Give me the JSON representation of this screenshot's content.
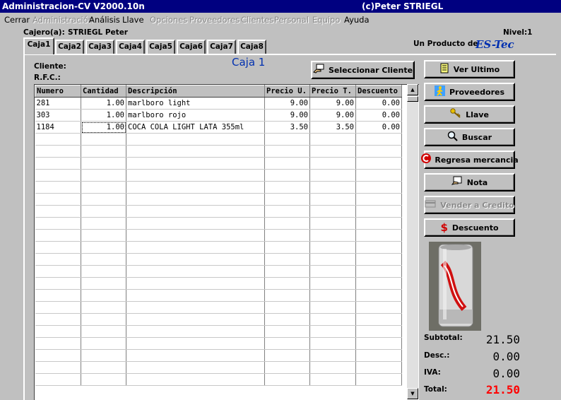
{
  "window": {
    "title": "Administracion-CV V2000.10n",
    "copyright": "(c)Peter STRIEGL"
  },
  "menu": [
    {
      "label": "Cerrar",
      "enabled": true
    },
    {
      "label": "Administración",
      "enabled": false
    },
    {
      "label": "Análisis",
      "enabled": true
    },
    {
      "label": "Llave",
      "enabled": true
    },
    {
      "label": "Opciones",
      "enabled": false
    },
    {
      "label": "Proveedores",
      "enabled": false
    },
    {
      "label": "Clientes",
      "enabled": false
    },
    {
      "label": "Personal",
      "enabled": false
    },
    {
      "label": "Equipo",
      "enabled": false
    },
    {
      "label": "Ayuda",
      "enabled": true
    }
  ],
  "header": {
    "cajero_label": "Cajero(a):",
    "cajero_name": "STRIEGL Peter",
    "nivel": "Nivel:1",
    "producto_label": "Un Producto de",
    "brand": "ES-Tec"
  },
  "tabs": [
    "Caja1",
    "Caja2",
    "Caja3",
    "Caja4",
    "Caja5",
    "Caja6",
    "Caja7",
    "Caja8"
  ],
  "active_tab": "Caja1",
  "caja_title": "Caja 1",
  "cliente_label": "Cliente:",
  "rfc_label": "R.F.C.:",
  "seleccionar_cliente": "Seleccionar Cliente",
  "table": {
    "columns": [
      "Numero",
      "Cantidad",
      "Descripción",
      "Precio U.",
      "Precio T.",
      "Descuento"
    ],
    "rows": [
      [
        "281",
        "1.00",
        "marlboro light",
        "9.00",
        "9.00",
        "0.00"
      ],
      [
        "303",
        "1.00",
        "marlboro rojo",
        "9.00",
        "9.00",
        "0.00"
      ],
      [
        "1184",
        "1.00",
        "COCA COLA LIGHT LATA 355ml",
        "3.50",
        "3.50",
        "0.00"
      ]
    ]
  },
  "buttons": {
    "ver_ultimo": "Ver Ultimo",
    "proveedores": "Proveedores",
    "llave": "Llave",
    "buscar": "Buscar",
    "regresa": "Regresa mercancia",
    "nota": "Nota",
    "vender_credito": "Vender a Credito",
    "descuento": "Descuento"
  },
  "product_image": {
    "icon": "coca-cola-light-can"
  },
  "totals": {
    "subtotal_label": "Subtotal:",
    "subtotal": "21.50",
    "desc_label": "Desc.:",
    "desc": "0.00",
    "iva_label": "IVA:",
    "iva": "0.00",
    "total_label": "Total:",
    "total": "21.50"
  },
  "colors": {
    "titlebar": "#000080",
    "caja_title": "#0030b0",
    "brand": "#0030b0",
    "total": "#ff0000"
  }
}
